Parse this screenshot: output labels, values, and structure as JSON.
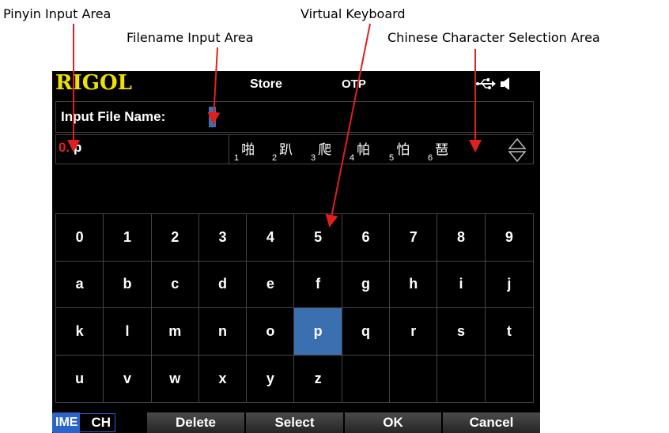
{
  "callouts": {
    "pinyin_input_area": "Pinyin Input Area",
    "filename_input_area": "Filename Input Area",
    "virtual_keyboard": "Virtual Keyboard",
    "chinese_selection_area": "Chinese Character Selection Area"
  },
  "title_bar": {
    "logo": "RIGOL",
    "mode": "Store",
    "status": "OTP",
    "icons": [
      "usb-icon",
      "speaker-icon"
    ]
  },
  "filename": {
    "label": "Input File Name:",
    "value": ""
  },
  "pinyin": {
    "index": "0.",
    "text": "p",
    "candidates": [
      {
        "num": "1",
        "char": "啪"
      },
      {
        "num": "2",
        "char": "趴"
      },
      {
        "num": "3",
        "char": "爬"
      },
      {
        "num": "4",
        "char": "帕"
      },
      {
        "num": "5",
        "char": "怕"
      },
      {
        "num": "6",
        "char": "琶"
      }
    ]
  },
  "keyboard": {
    "rows": [
      [
        "0",
        "1",
        "2",
        "3",
        "4",
        "5",
        "6",
        "7",
        "8",
        "9"
      ],
      [
        "a",
        "b",
        "c",
        "d",
        "e",
        "f",
        "g",
        "h",
        "i",
        "j"
      ],
      [
        "k",
        "l",
        "m",
        "n",
        "o",
        "p",
        "q",
        "r",
        "s",
        "t"
      ],
      [
        "u",
        "v",
        "w",
        "x",
        "y",
        "z",
        "",
        "",
        "",
        ""
      ]
    ],
    "selected": "p"
  },
  "softkeys": {
    "ime_label": "IME",
    "ime_value": "CH",
    "delete": "Delete",
    "select": "Select",
    "ok": "OK",
    "cancel": "Cancel"
  },
  "colors": {
    "logo": "#f0e000",
    "selected_key": "#3a6fb0",
    "callout_arrow": "#e02020",
    "pinyin_index": "#e02020"
  }
}
